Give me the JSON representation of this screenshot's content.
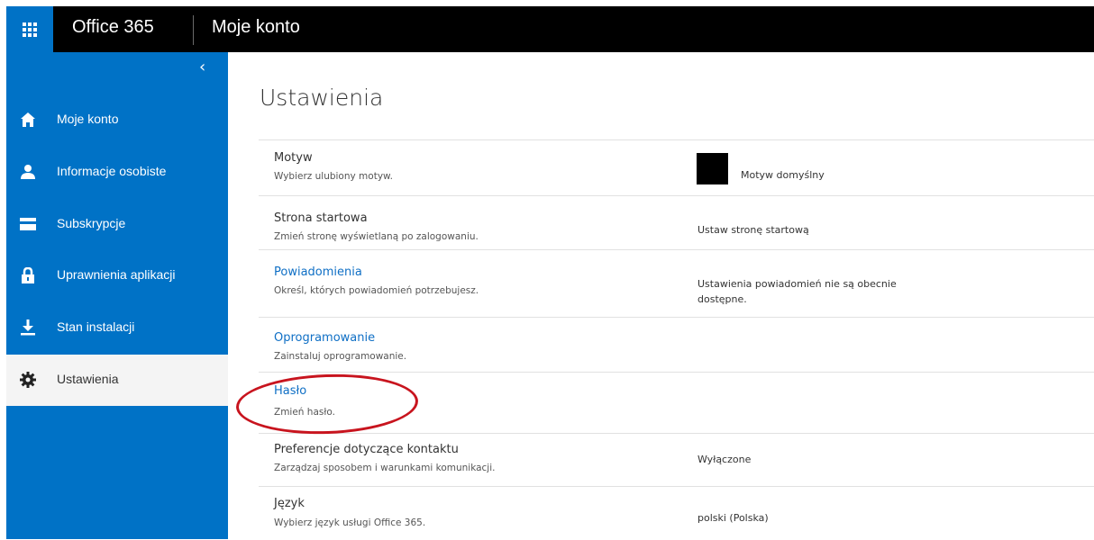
{
  "header": {
    "brand": "Office 365",
    "page": "Moje konto",
    "app_launcher_icon": "waffle-icon"
  },
  "sidebar": {
    "collapse_glyph": "‹",
    "items": [
      {
        "label": "Moje konto",
        "icon": "home-icon"
      },
      {
        "label": "Informacje osobiste",
        "icon": "person-icon"
      },
      {
        "label": "Subskrypcje",
        "icon": "card-icon"
      },
      {
        "label": "Uprawnienia aplikacji",
        "icon": "lock-icon"
      },
      {
        "label": "Stan instalacji",
        "icon": "download-icon"
      },
      {
        "label": "Ustawienia",
        "icon": "gear-icon",
        "active": true
      }
    ]
  },
  "main": {
    "title": "Ustawienia",
    "rows": [
      {
        "title": "Motyw",
        "desc": "Wybierz ulubiony motyw.",
        "value": "Motyw domyślny",
        "link": false
      },
      {
        "title": "Strona startowa",
        "desc": "Zmień stronę wyświetlaną po zalogowaniu.",
        "value": "Ustaw stronę startową",
        "link": false
      },
      {
        "title": "Powiadomienia",
        "desc": "Określ, których powiadomień potrzebujesz.",
        "value": "Ustawienia powiadomień nie są obecnie dostępne.",
        "link": true
      },
      {
        "title": "Oprogramowanie",
        "desc": "Zainstaluj oprogramowanie.",
        "value": "",
        "link": true
      },
      {
        "title": "Hasło",
        "desc": "Zmień hasło.",
        "value": "",
        "link": true
      },
      {
        "title": "Preferencje dotyczące kontaktu",
        "desc": "Zarządzaj sposobem i warunkami komunikacji.",
        "value": "Wyłączone",
        "link": false
      },
      {
        "title": "Język",
        "desc": "Wybierz język usługi Office 365.",
        "value": "polski (Polska)",
        "link": false
      }
    ]
  },
  "colors": {
    "accent": "#0072c6",
    "link": "#0f6fc5",
    "highlight_circle": "#c8141e",
    "theme_swatch": "#000000"
  }
}
